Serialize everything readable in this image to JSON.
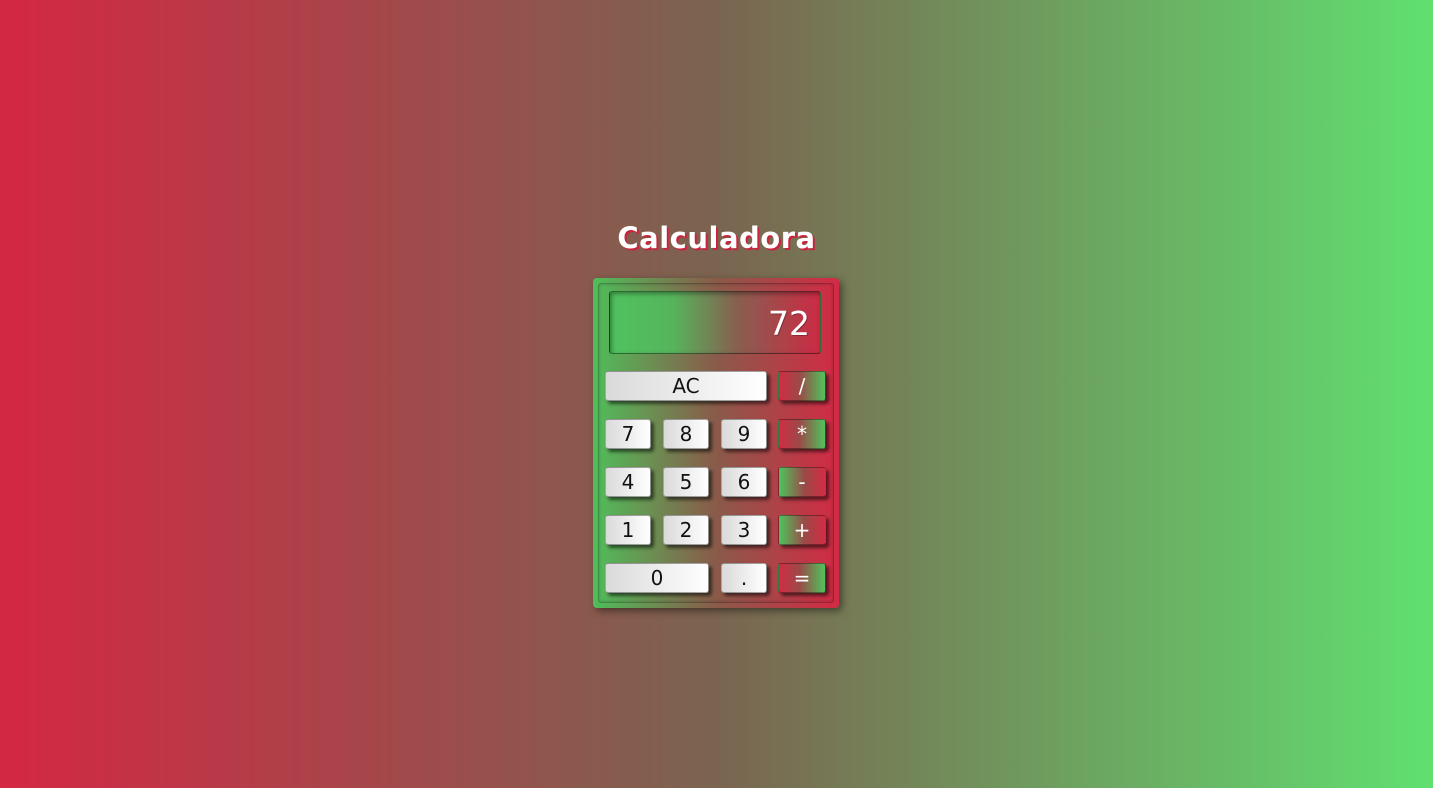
{
  "title": "Calculadora",
  "display": {
    "value": "72"
  },
  "buttons": {
    "clear": "AC",
    "divide": "/",
    "multiply": "*",
    "subtract": "-",
    "add": "+",
    "equals": "=",
    "decimal": ".",
    "d0": "0",
    "d1": "1",
    "d2": "2",
    "d3": "3",
    "d4": "4",
    "d5": "5",
    "d6": "6",
    "d7": "7",
    "d8": "8",
    "d9": "9"
  },
  "colors": {
    "background_left": "#d42744",
    "background_right": "#60e070",
    "operator_red": "#d22c44",
    "operator_green": "#4ec45c"
  }
}
